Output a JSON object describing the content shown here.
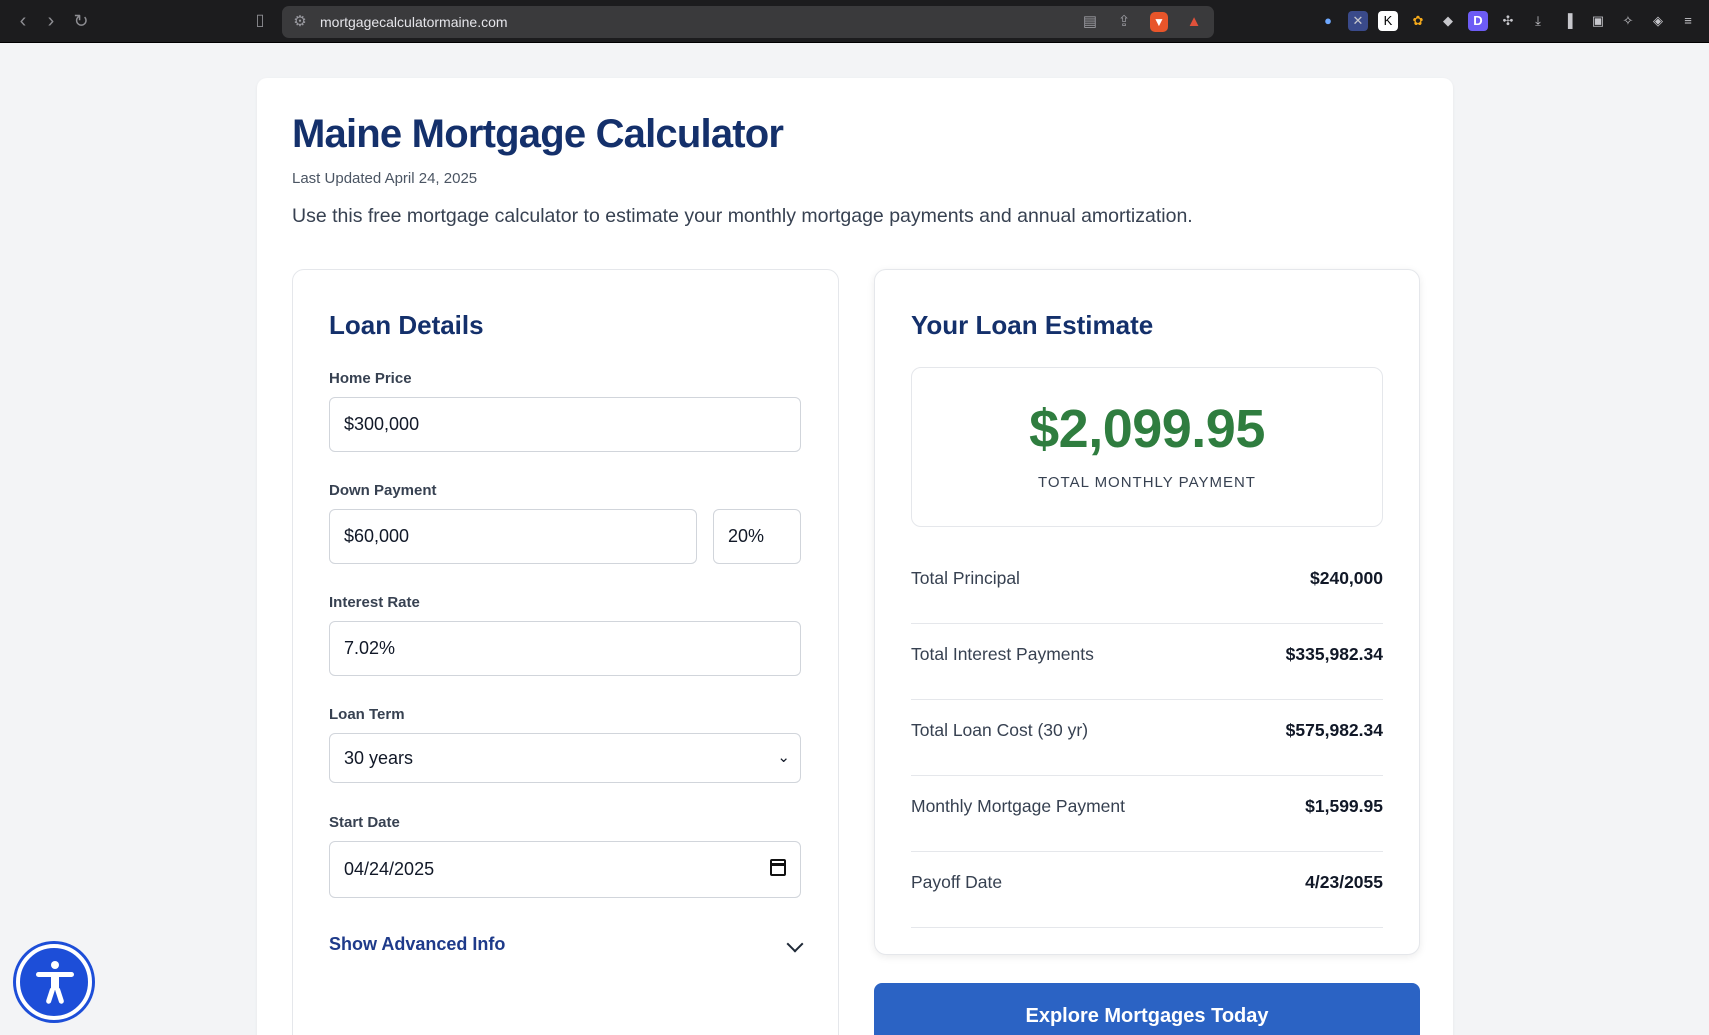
{
  "browser": {
    "url": "mortgagecalculatormaine.com"
  },
  "page": {
    "title": "Maine Mortgage Calculator",
    "updated": "Last Updated April 24, 2025",
    "intro": "Use this free mortgage calculator to estimate your monthly mortgage payments and annual amortization."
  },
  "loan_details": {
    "heading": "Loan Details",
    "home_price_label": "Home Price",
    "home_price_value": "$300,000",
    "down_payment_label": "Down Payment",
    "down_payment_value": "$60,000",
    "down_payment_percent": "20%",
    "interest_rate_label": "Interest Rate",
    "interest_rate_value": "7.02%",
    "loan_term_label": "Loan Term",
    "loan_term_value": "30 years",
    "start_date_label": "Start Date",
    "start_date_value": "04/24/2025",
    "advanced_label": "Show Advanced Info"
  },
  "estimate": {
    "heading": "Your Loan Estimate",
    "monthly_total": "$2,099.95",
    "monthly_total_label": "TOTAL MONTHLY PAYMENT",
    "rows": [
      {
        "label": "Total Principal",
        "value": "$240,000"
      },
      {
        "label": "Total Interest Payments",
        "value": "$335,982.34"
      },
      {
        "label": "Total Loan Cost (30 yr)",
        "value": "$575,982.34"
      },
      {
        "label": "Monthly Mortgage Payment",
        "value": "$1,599.95"
      },
      {
        "label": "Payoff Date",
        "value": "4/23/2055"
      }
    ],
    "cta_label": "Explore Mortgages Today"
  },
  "colors": {
    "heading": "#14306b",
    "amount_green": "#2f7d3f",
    "cta_blue": "#2b63c4",
    "a11y_blue": "#1d4ed8"
  }
}
